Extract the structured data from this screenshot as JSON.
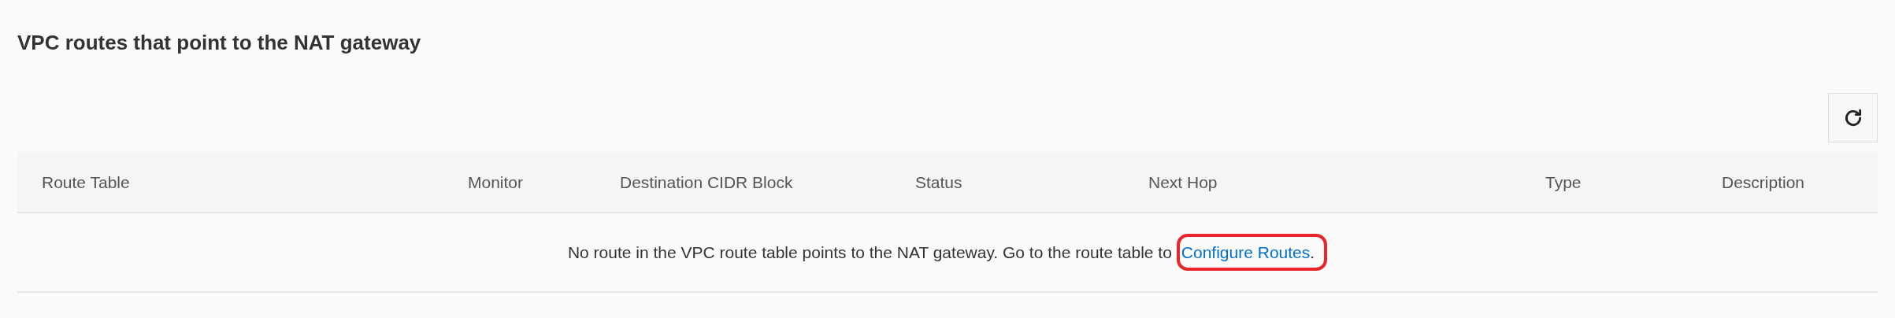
{
  "title": "VPC routes that point to the NAT gateway",
  "table": {
    "columns": [
      "Route Table",
      "Monitor",
      "Destination CIDR Block",
      "Status",
      "Next Hop",
      "Type",
      "Description"
    ],
    "empty_message": {
      "text": "No route in the VPC route table points to the NAT gateway. Go to the route table to ",
      "link": "Configure Routes",
      "link_highlighted": true,
      "end": "."
    }
  }
}
